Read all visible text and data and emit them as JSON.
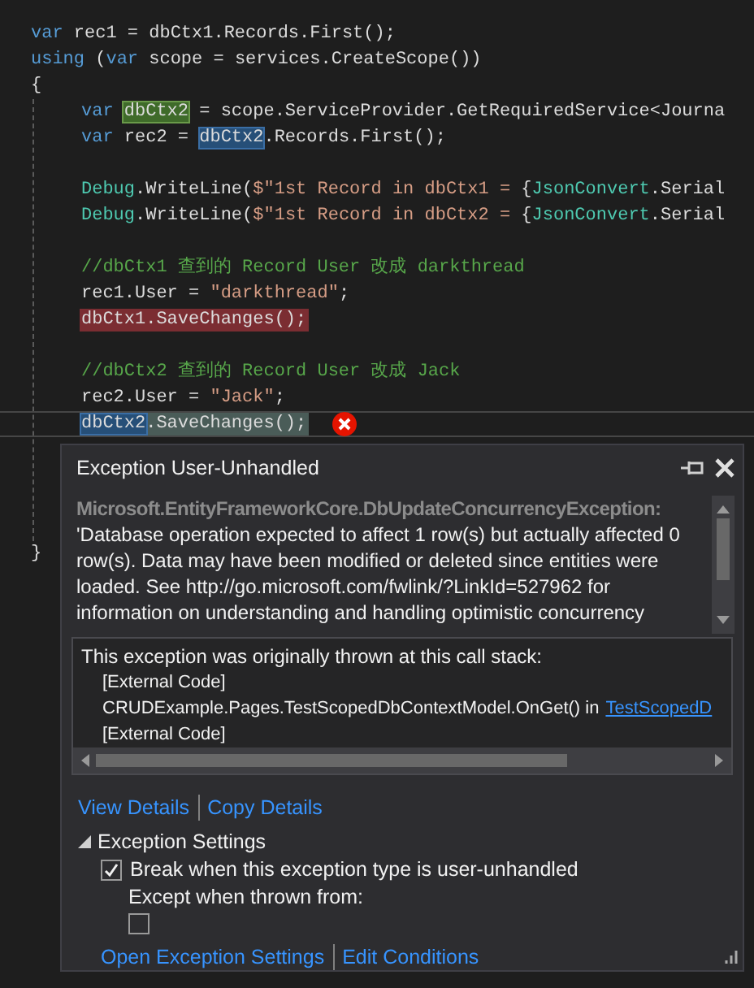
{
  "editor": {
    "lines": [
      {
        "kind": "code",
        "tokens": [
          {
            "text": "var",
            "kind": "keyword"
          },
          {
            "text": " rec1 = dbCtx1.Records.First();",
            "kind": "text"
          }
        ]
      },
      {
        "kind": "code",
        "tokens": [
          {
            "text": "using",
            "kind": "keyword"
          },
          {
            "text": " (",
            "kind": "text"
          },
          {
            "text": "var",
            "kind": "keyword"
          },
          {
            "text": " scope = services.CreateScope())",
            "kind": "text"
          }
        ]
      },
      {
        "kind": "code",
        "tokens": [
          {
            "text": "{",
            "kind": "text"
          }
        ]
      },
      {
        "kind": "block",
        "lines": [
          {
            "kind": "code",
            "tokens": [
              {
                "text": "var ",
                "kind": "keyword"
              },
              {
                "text": "dbCtx2",
                "kind": "text",
                "write_highlight": true
              },
              {
                "text": " = scope.ServiceProvider.GetRequiredService<Journa",
                "kind": "text"
              }
            ]
          },
          {
            "kind": "code",
            "tokens": [
              {
                "text": "var",
                "kind": "keyword"
              },
              {
                "text": " rec2 = ",
                "kind": "text"
              },
              {
                "text": "dbCtx2",
                "kind": "text",
                "read_highlight": true
              },
              {
                "text": ".Records.First();",
                "kind": "text"
              }
            ]
          },
          {
            "kind": "blank"
          },
          {
            "kind": "code",
            "tokens": [
              {
                "text": "Debug",
                "kind": "type"
              },
              {
                "text": ".WriteLine(",
                "kind": "text"
              },
              {
                "text": "$\"1st Record in dbCtx1 = ",
                "kind": "string"
              },
              {
                "text": "{",
                "kind": "text"
              },
              {
                "text": "JsonConvert",
                "kind": "type"
              },
              {
                "text": ".Serial",
                "kind": "text"
              }
            ]
          },
          {
            "kind": "code",
            "tokens": [
              {
                "text": "Debug",
                "kind": "type"
              },
              {
                "text": ".WriteLine(",
                "kind": "text"
              },
              {
                "text": "$\"1st Record in dbCtx2 = ",
                "kind": "string"
              },
              {
                "text": "{",
                "kind": "text"
              },
              {
                "text": "JsonConvert",
                "kind": "type"
              },
              {
                "text": ".Serial",
                "kind": "text"
              }
            ]
          },
          {
            "kind": "blank"
          },
          {
            "kind": "code",
            "tokens": [
              {
                "text": "//dbCtx1 查到的 Record User 改成 darkthread",
                "kind": "comment"
              }
            ]
          },
          {
            "kind": "code",
            "tokens": [
              {
                "text": "rec1.User = ",
                "kind": "text"
              },
              {
                "text": "\"darkthread\"",
                "kind": "string"
              },
              {
                "text": ";",
                "kind": "text"
              }
            ]
          },
          {
            "kind": "code",
            "breakpoint": true,
            "tokens": [
              {
                "text": "dbCtx1.SaveChanges();",
                "kind": "text"
              }
            ]
          },
          {
            "kind": "blank"
          },
          {
            "kind": "code",
            "tokens": [
              {
                "text": "//dbCtx2 查到的 Record User 改成 Jack",
                "kind": "comment"
              }
            ]
          },
          {
            "kind": "code",
            "tokens": [
              {
                "text": "rec2.User = ",
                "kind": "text"
              },
              {
                "text": "\"Jack\"",
                "kind": "string"
              },
              {
                "text": ";",
                "kind": "text"
              }
            ]
          },
          {
            "kind": "code",
            "current_statement": true,
            "error": true,
            "tokens": [
              {
                "text": "dbCtx2",
                "kind": "text",
                "read_highlight": true
              },
              {
                "text": ".SaveChanges();",
                "kind": "text"
              }
            ]
          },
          {
            "kind": "blank"
          },
          {
            "kind": "blank"
          },
          {
            "kind": "blank"
          },
          {
            "kind": "blank"
          }
        ]
      },
      {
        "kind": "code",
        "tokens": [
          {
            "text": "}",
            "kind": "text"
          }
        ]
      }
    ]
  },
  "exception_popup": {
    "title": "Exception User-Unhandled",
    "exception_type": "Microsoft.EntityFrameworkCore.DbUpdateConcurrencyException:",
    "message": "'Database operation expected to affect 1 row(s) but actually affected 0 row(s). Data may have been modified or deleted since entities were loaded. See http://go.microsoft.com/fwlink/?LinkId=527962 for information on understanding and handling optimistic concurrency",
    "call_stack": {
      "heading": "This exception was originally thrown at this call stack:",
      "frames": [
        {
          "text": "[External Code]"
        },
        {
          "text": "CRUDExample.Pages.TestScopedDbContextModel.OnGet() in",
          "link": "TestScopedD"
        },
        {
          "text": "[External Code]"
        }
      ]
    },
    "links": [
      "View Details",
      "Copy Details"
    ],
    "settings": {
      "label": "Exception Settings",
      "expanded": true,
      "break_option": {
        "label": "Break when this exception type is user-unhandled",
        "checked": true
      },
      "except_label": "Except when thrown from:",
      "except_checkbox": {
        "checked": false
      }
    },
    "footer_links": [
      "Open Exception Settings",
      "Edit Conditions"
    ]
  }
}
